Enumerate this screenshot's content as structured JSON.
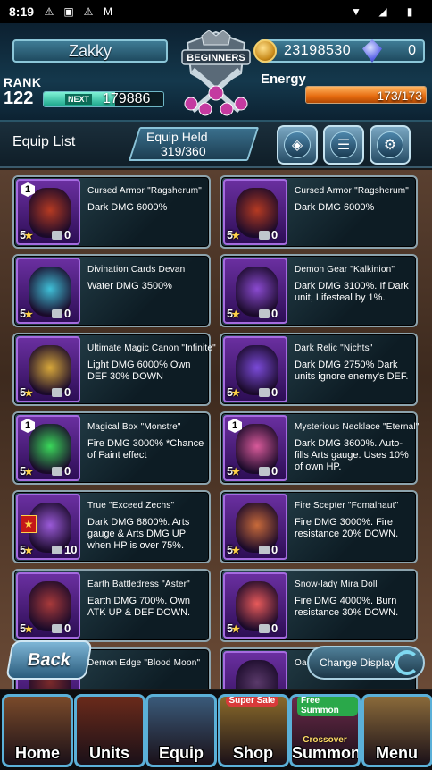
{
  "status_bar": {
    "time": "8:19"
  },
  "header": {
    "player_name": "Zakky",
    "crest_text": "BEGINNERS",
    "gil": "23198530",
    "gems": "0",
    "rank_label": "RANK",
    "rank": "122",
    "next_label": "NEXT",
    "next_exp": "179886",
    "rank_progress": 0.6,
    "energy_label": "Energy",
    "energy": "173/173",
    "energy_fraction": 1.0
  },
  "list_bar": {
    "title": "Equip List",
    "held_label": "Equip Held",
    "held_value": "319/360"
  },
  "items": [
    {
      "name": "Cursed Armor \"Ragsherum\"",
      "desc": "Dark DMG 6000%",
      "rarity": "5",
      "count": "0",
      "tier": "1",
      "color": "#b53a22"
    },
    {
      "name": "Cursed Armor \"Ragsherum\"",
      "desc": "Dark DMG 6000%",
      "rarity": "5",
      "count": "0",
      "tier": "",
      "color": "#b53a22"
    },
    {
      "name": "Divination Cards Devan",
      "desc": "Water DMG 3500%",
      "rarity": "5",
      "count": "0",
      "tier": "",
      "color": "#3fc0d8"
    },
    {
      "name": "Demon Gear \"Kalkinion\"",
      "desc": "Dark DMG 3100%. If Dark unit, Lifesteal by 1%.",
      "rarity": "5",
      "count": "0",
      "tier": "",
      "color": "#8a4ad0"
    },
    {
      "name": "Ultimate Magic Canon \"Infinite\"",
      "desc": "Light DMG 6000% Own DEF 30% DOWN",
      "rarity": "5",
      "count": "0",
      "tier": "",
      "color": "#d8a83a"
    },
    {
      "name": "Dark Relic \"Nichts\"",
      "desc": "Dark DMG 2750% Dark units ignore enemy's DEF.",
      "rarity": "5",
      "count": "0",
      "tier": "",
      "color": "#7a4ad8"
    },
    {
      "name": "Magical Box \"Monstre\"",
      "desc": "Fire DMG 3000% *Chance of Faint effect",
      "rarity": "5",
      "count": "0",
      "tier": "1",
      "color": "#3ad85a"
    },
    {
      "name": "Mysterious Necklace \"Eternal\"",
      "desc": "Dark DMG 3600%. Auto-fills Arts gauge. Uses 10% of own HP.",
      "rarity": "5",
      "count": "0",
      "tier": "1",
      "color": "#d85a9a"
    },
    {
      "name": "True \"Exceed Zechs\"",
      "desc": "Dark DMG 8800%. Arts gauge & Arts DMG UP when HP is over 75%.",
      "rarity": "5",
      "count": "10",
      "tier": "",
      "color": "#9a5ad8",
      "ex": "★"
    },
    {
      "name": "Fire Scepter \"Fomalhaut\"",
      "desc": "Fire DMG 3000%. Fire resistance 20% DOWN.",
      "rarity": "5",
      "count": "0",
      "tier": "",
      "color": "#c86a3a"
    },
    {
      "name": "Earth Battledress \"Aster\"",
      "desc": "Earth DMG 700%. Own ATK UP & DEF DOWN.",
      "rarity": "5",
      "count": "0",
      "tier": "",
      "color": "#a83a3a"
    },
    {
      "name": "Snow-lady Mira Doll",
      "desc": "Fire DMG 4000%. Burn resistance 30% DOWN.",
      "rarity": "5",
      "count": "0",
      "tier": "",
      "color": "#e85a5a"
    },
    {
      "name": "Demon Edge \"Blood Moon\"",
      "desc": "",
      "rarity": "",
      "count": "",
      "tier": "",
      "color": "#7a2a2a"
    },
    {
      "name": "Oa",
      "desc": "",
      "rarity": "",
      "count": "",
      "tier": "",
      "color": "#5a3a6a"
    }
  ],
  "controls": {
    "back_label": "Back",
    "change_display_label": "Change Display"
  },
  "nav": [
    {
      "label": "Home",
      "bg": "#7a4a2a"
    },
    {
      "label": "Units",
      "bg": "#6a2a1a"
    },
    {
      "label": "Equip",
      "bg": "#3a5a7a"
    },
    {
      "label": "Shop",
      "bg": "#8a6a2a",
      "badge": "Super Sale",
      "badge_color": "#d83a3a"
    },
    {
      "label": "Summon",
      "bg": "#6a2a4a",
      "badge": "Free Summon",
      "badge_color": "#2aa84a",
      "sub": "Crossover"
    },
    {
      "label": "Menu",
      "bg": "#8a6a3a"
    }
  ]
}
